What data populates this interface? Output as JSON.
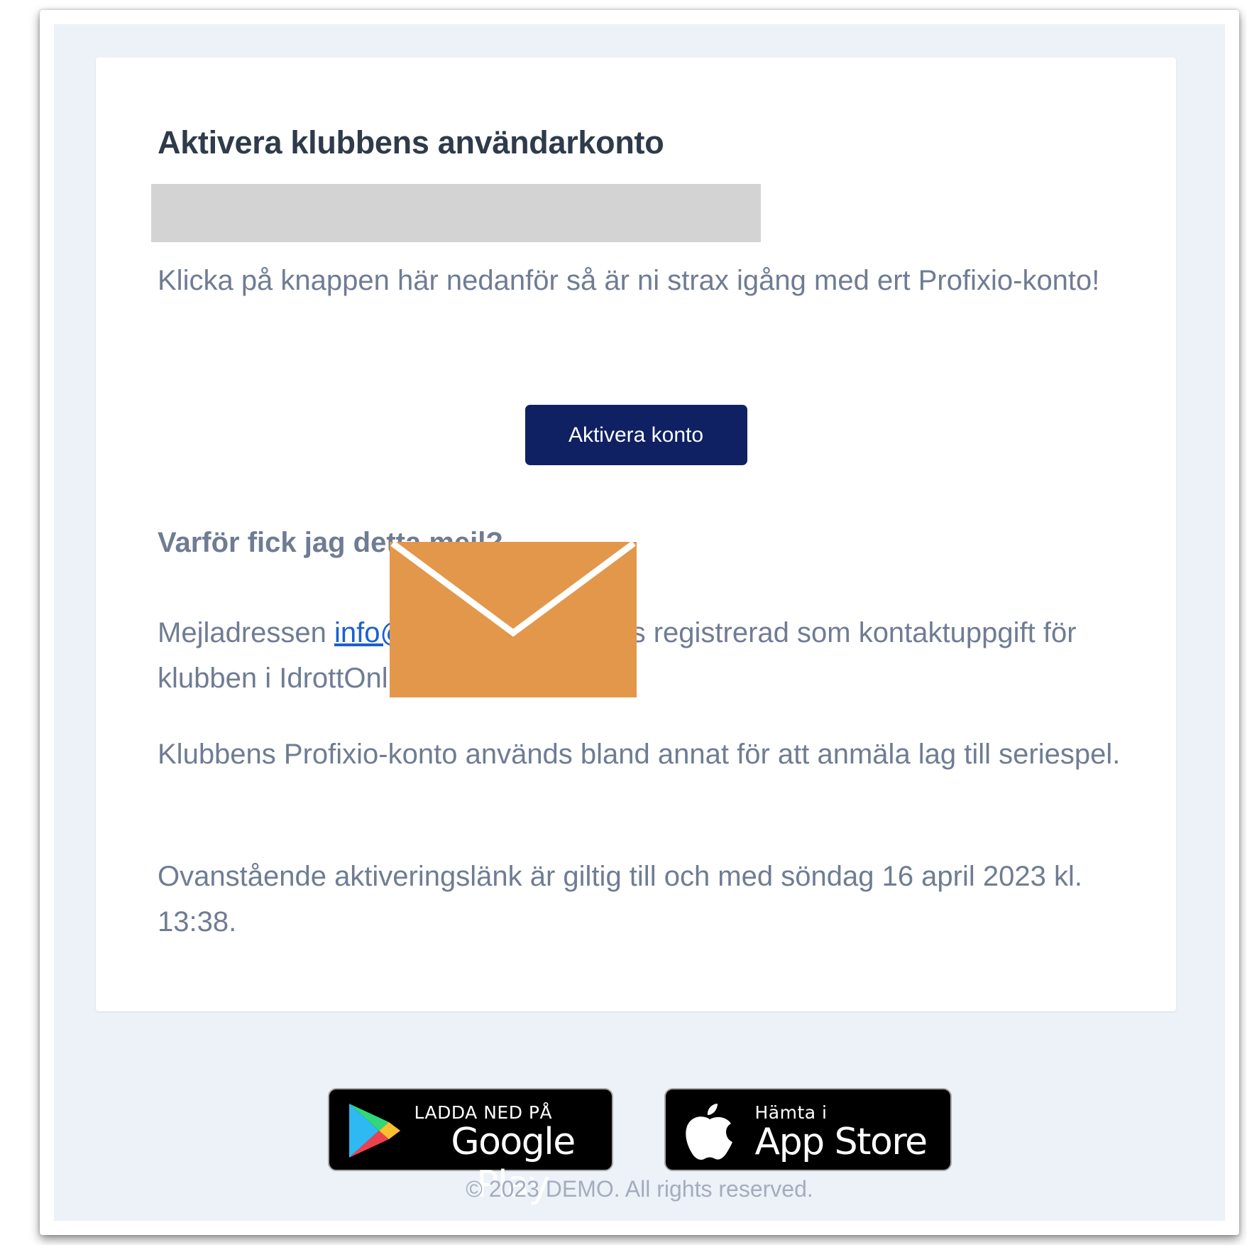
{
  "email": {
    "title": "Aktivera klubbens användarkonto",
    "intro": "Klicka på knappen här nedanför så är ni strax igång med ert Profixio-konto!",
    "activate_button": "Aktivera konto",
    "why_heading": "Varför fick jag detta mejl?",
    "why_text_before": "Mejladressen ",
    "why_link": "info@example.com",
    "why_text_mid": " finns registrerad som kontaktuppgift för klubben i IdrottOnline.",
    "usage_text": "Klubbens Profixio-konto används bland annat för att anmäla lag till seriespel.",
    "validity_text": "Ovanstående aktiveringslänk är giltig till och med söndag 16 april 2023 kl. 13:38."
  },
  "footer": {
    "google_play": {
      "small": "LADDA NED PÅ",
      "big": "Google Play",
      "icon": "google-play-icon"
    },
    "app_store": {
      "small": "Hämta i",
      "big": "App Store",
      "icon": "apple-icon"
    },
    "copyright": "© 2023 DEMO. All rights reserved."
  },
  "colors": {
    "button": "#0f2163",
    "heading": "#2f3b4a",
    "body_text": "#6f7c93",
    "link": "#1a5fd6",
    "background": "#edf1f8",
    "envelope": "#e3974a"
  }
}
